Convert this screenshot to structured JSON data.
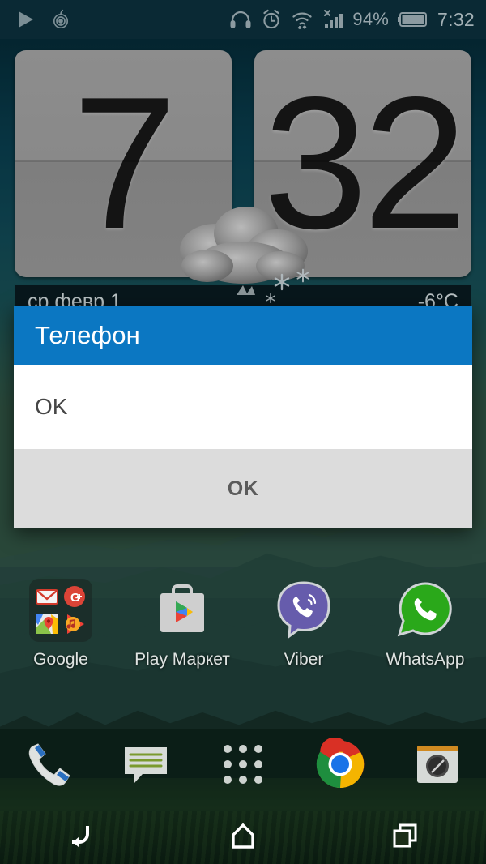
{
  "statusbar": {
    "left_icons": [
      {
        "name": "media-play-icon",
        "glyph": "play"
      },
      {
        "name": "tor-orbot-icon",
        "glyph": "spiral"
      }
    ],
    "right_icons": [
      {
        "name": "headphones-icon",
        "glyph": "headphones"
      },
      {
        "name": "alarm-clock-icon",
        "glyph": "alarm"
      },
      {
        "name": "wifi-icon",
        "glyph": "wifi-updown"
      },
      {
        "name": "no-sim-signal-icon",
        "glyph": "signal-x"
      }
    ],
    "battery_percent": "94%",
    "battery_icon": "battery-icon",
    "clock": "7:32"
  },
  "clock_widget": {
    "hours": "7",
    "minutes": "32",
    "date": "ср февр 1",
    "temperature": "-6°C",
    "weather_icon": "snow-cloud-icon"
  },
  "dialog": {
    "title": "Телефон",
    "message": "OK",
    "ok_label": "OK",
    "header_color": "#0b77c2",
    "footer_color": "#dcdcdc",
    "button_text_color": "#5b5b5b"
  },
  "apps": [
    {
      "label": "Google",
      "icon": "google-folder-icon"
    },
    {
      "label": "Play Маркет",
      "icon": "play-store-icon"
    },
    {
      "label": "Viber",
      "icon": "viber-icon"
    },
    {
      "label": "WhatsApp",
      "icon": "whatsapp-icon"
    }
  ],
  "dock": [
    {
      "name": "phone-icon"
    },
    {
      "name": "messages-icon"
    },
    {
      "name": "app-drawer-icon"
    },
    {
      "name": "chrome-icon"
    },
    {
      "name": "camera-icon"
    }
  ],
  "navbar": [
    {
      "name": "back-icon"
    },
    {
      "name": "home-icon"
    },
    {
      "name": "recents-icon"
    }
  ]
}
